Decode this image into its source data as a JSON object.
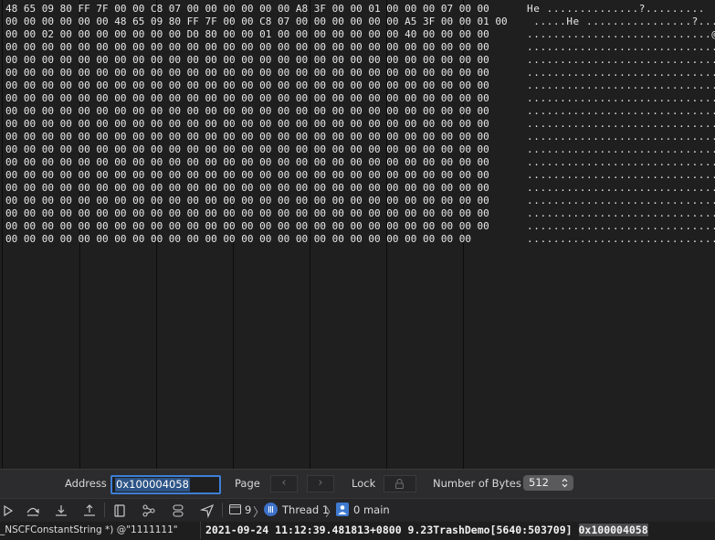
{
  "memory": {
    "hex_rows": [
      "48 65 09 80 FF 7F 00 00 C8 07 00 00 00 00 00 00 A8 3F 00 00 01 00 00 00 07 00 00",
      "00 00 00 00 00 00 48 65 09 80 FF 7F 00 00 C8 07 00 00 00 00 00 00 A5 3F 00 00 01 00",
      "00 00 02 00 00 00 00 00 00 00 D0 80 00 00 01 00 00 00 00 00 00 00 40 00 00 00 00",
      "00 00 00 00 00 00 00 00 00 00 00 00 00 00 00 00 00 00 00 00 00 00 00 00 00 00 00",
      "00 00 00 00 00 00 00 00 00 00 00 00 00 00 00 00 00 00 00 00 00 00 00 00 00 00 00",
      "00 00 00 00 00 00 00 00 00 00 00 00 00 00 00 00 00 00 00 00 00 00 00 00 00 00 00",
      "00 00 00 00 00 00 00 00 00 00 00 00 00 00 00 00 00 00 00 00 00 00 00 00 00 00 00",
      "00 00 00 00 00 00 00 00 00 00 00 00 00 00 00 00 00 00 00 00 00 00 00 00 00 00 00",
      "00 00 00 00 00 00 00 00 00 00 00 00 00 00 00 00 00 00 00 00 00 00 00 00 00 00 00",
      "00 00 00 00 00 00 00 00 00 00 00 00 00 00 00 00 00 00 00 00 00 00 00 00 00 00 00",
      "00 00 00 00 00 00 00 00 00 00 00 00 00 00 00 00 00 00 00 00 00 00 00 00 00 00 00",
      "00 00 00 00 00 00 00 00 00 00 00 00 00 00 00 00 00 00 00 00 00 00 00 00 00 00 00",
      "00 00 00 00 00 00 00 00 00 00 00 00 00 00 00 00 00 00 00 00 00 00 00 00 00 00 00",
      "00 00 00 00 00 00 00 00 00 00 00 00 00 00 00 00 00 00 00 00 00 00 00 00 00 00 00",
      "00 00 00 00 00 00 00 00 00 00 00 00 00 00 00 00 00 00 00 00 00 00 00 00 00 00 00",
      "00 00 00 00 00 00 00 00 00 00 00 00 00 00 00 00 00 00 00 00 00 00 00 00 00 00 00",
      "00 00 00 00 00 00 00 00 00 00 00 00 00 00 00 00 00 00 00 00 00 00 00 00 00 00 00",
      "00 00 00 00 00 00 00 00 00 00 00 00 00 00 00 00 00 00 00 00 00 00 00 00 00 00 00",
      "00 00 00 00 00 00 00 00 00 00 00 00 00 00 00 00 00 00 00 00 00 00 00 00 00 00"
    ],
    "ascii_rows": [
      "He ..............?.........",
      " .....He ................?...",
      "............................@...",
      "................................",
      "................................",
      "................................",
      "................................",
      "................................",
      "................................",
      "................................",
      "................................",
      "................................",
      "................................",
      "................................",
      "................................",
      "................................",
      "................................",
      "................................",
      "..............................."
    ]
  },
  "address_bar": {
    "address_label": "Address",
    "address_value": "0x100004058",
    "page_label": "Page",
    "prev_symbol": "‹",
    "next_symbol": "›",
    "lock_label": "Lock",
    "bytes_label": "Number of Bytes",
    "bytes_value": "512"
  },
  "debug_bar": {
    "frame_count": "9",
    "crumb_separator": "〉",
    "thread_label": "Thread 1",
    "frame_label": "0 main",
    "icons": [
      "continue-icon",
      "step-over-icon",
      "step-into-icon",
      "step-out-icon",
      "view-hierarchy-icon",
      "memory-graph-icon",
      "environment-overrides-icon",
      "simulate-location-icon"
    ]
  },
  "variables_pane": {
    "text": "_NSCFConstantString *) @\"1111111\""
  },
  "console": {
    "log_text": "2021-09-24 11:12:39.481813+0800 9.23TrashDemo[5640:503709] ",
    "highlighted": "0x100004058"
  },
  "colors": {
    "accent": "#3e7fd6",
    "thread_blue": "#3d72c9",
    "background": "#1f1f1f"
  }
}
